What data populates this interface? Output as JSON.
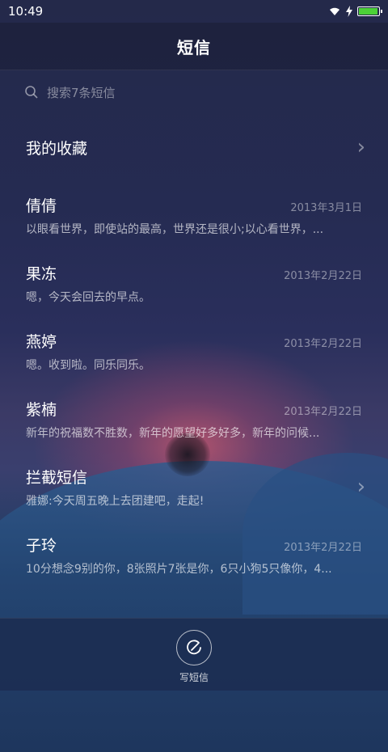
{
  "status_bar": {
    "time": "10:49"
  },
  "header": {
    "title": "短信"
  },
  "search": {
    "placeholder": "搜索7条短信"
  },
  "favorites": {
    "label": "我的收藏"
  },
  "conversations": [
    {
      "name": "倩倩",
      "date": "2013年3月1日",
      "preview": "以眼看世界，即使站的最高，世界还是很小;以心看世界，..."
    },
    {
      "name": "果冻",
      "date": "2013年2月22日",
      "preview": "嗯，今天会回去的早点。"
    },
    {
      "name": "燕婷",
      "date": "2013年2月22日",
      "preview": "嗯。收到啦。同乐同乐。"
    },
    {
      "name": "紫楠",
      "date": "2013年2月22日",
      "preview": "新年的祝福数不胜数，新年的愿望好多好多，新年的问候..."
    }
  ],
  "blocked": {
    "label": "拦截短信",
    "preview": "雅娜:今天周五晚上去团建吧，走起!"
  },
  "last_conversation": {
    "name": "子玲",
    "date": "2013年2月22日",
    "preview": "10分想念9别的你，8张照片7张是你，6只小狗5只像你，4..."
  },
  "compose": {
    "label": "写短信"
  },
  "colors": {
    "battery": "#4cd137"
  }
}
